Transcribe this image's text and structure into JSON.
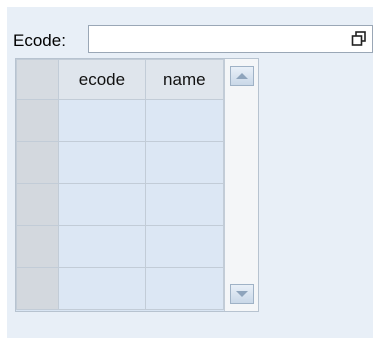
{
  "form": {
    "ecode_label": "Ecode:",
    "ecode_value": ""
  },
  "grid": {
    "columns": [
      "ecode",
      "name"
    ],
    "rows": [
      {
        "ecode": "",
        "name": ""
      },
      {
        "ecode": "",
        "name": ""
      },
      {
        "ecode": "",
        "name": ""
      },
      {
        "ecode": "",
        "name": ""
      },
      {
        "ecode": "",
        "name": ""
      }
    ]
  },
  "icons": {
    "lookup": "restore-window-icon",
    "scroll_up": "scroll-up-arrow-icon",
    "scroll_down": "scroll-down-arrow-icon"
  },
  "colors": {
    "panel_background": "#e8eff7",
    "cell_background": "#dce7f4",
    "row_header_background": "#d3d8de",
    "header_background": "#dfe5ec"
  }
}
